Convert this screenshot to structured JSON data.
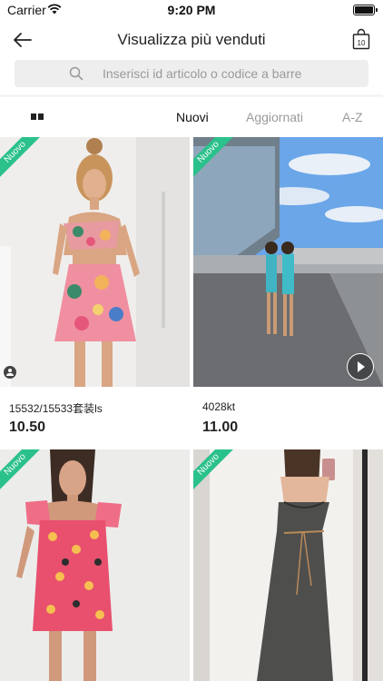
{
  "status_bar": {
    "carrier": "Carrier",
    "time": "9:20 PM"
  },
  "header": {
    "title": "Visualizza più venduti",
    "bag_count": "10"
  },
  "search": {
    "placeholder": "Inserisci id articolo o codice a barre"
  },
  "tabs": {
    "items": [
      "Nuovi",
      "Aggiornati",
      "A-Z"
    ],
    "active": "Nuovi"
  },
  "colors": {
    "accent_new": "#2bc18b",
    "search_bg": "#eeeeee"
  },
  "products": [
    {
      "badge": "Nuovo",
      "name": "15532/15533套装ls",
      "price": "10.50",
      "image": "woman-in-floral-ruffle-two-piece"
    },
    {
      "badge": "Nuovo",
      "name": "4028kt",
      "price": "11.00",
      "image": "two-women-in-blue-outfits-outdoors",
      "video": true
    },
    {
      "badge": "Nuovo",
      "image": "woman-in-floral-puff-sleeve-dress"
    },
    {
      "badge": "Nuovo",
      "image": "woman-in-black-slip-dress-mirror-selfie"
    }
  ]
}
